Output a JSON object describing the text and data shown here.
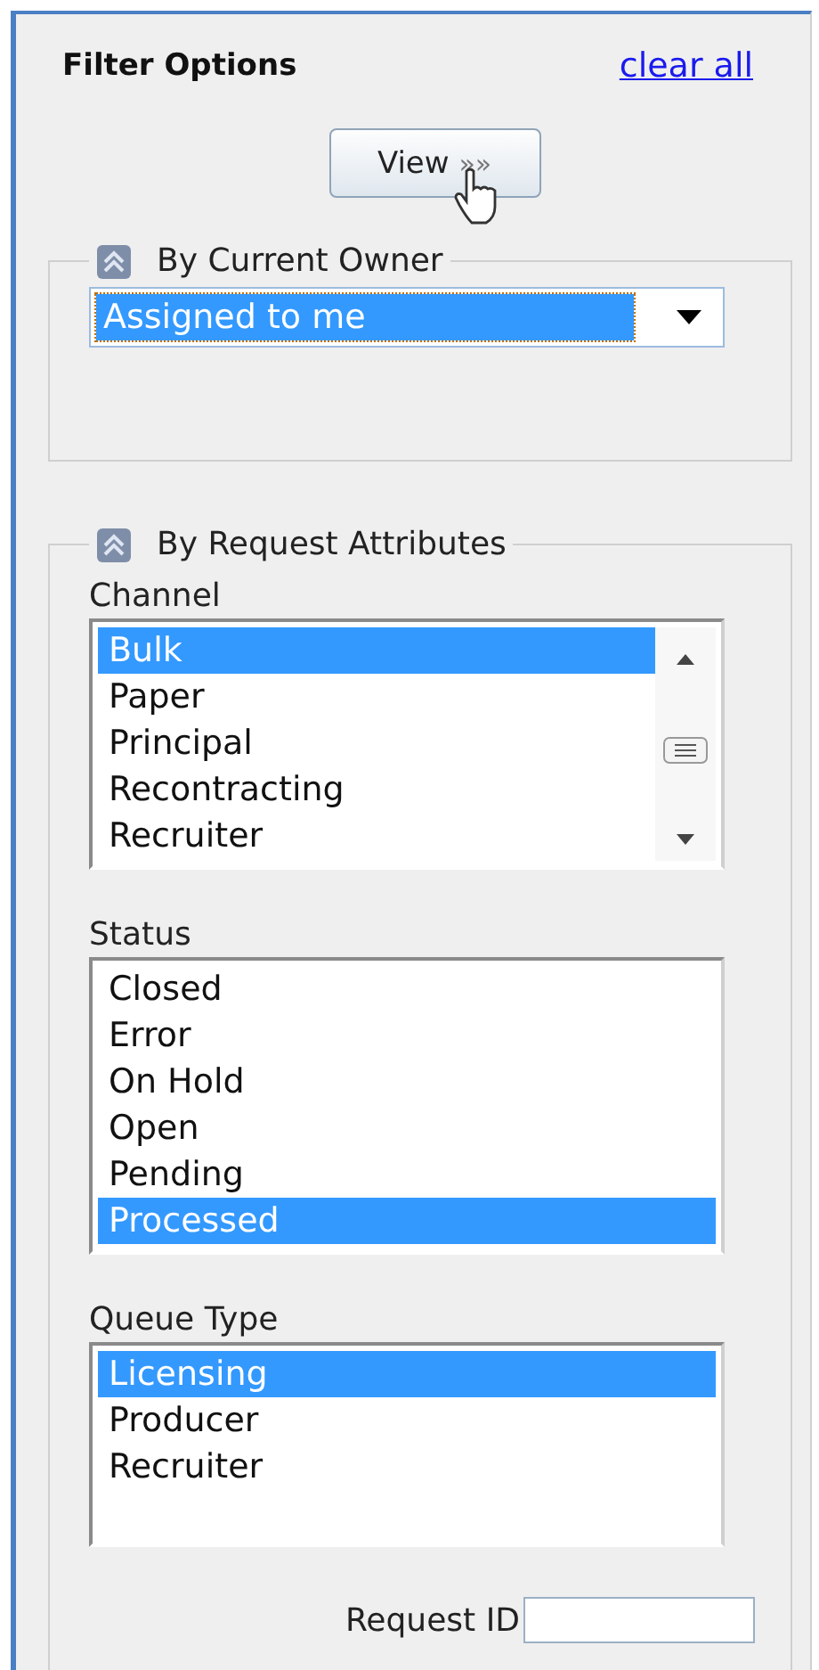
{
  "panel": {
    "title": "Filter Options",
    "clear_link": "clear all"
  },
  "view_button": {
    "label": "View",
    "arrows": "»»"
  },
  "owner_section": {
    "title": "By Current Owner",
    "expanded": true,
    "select": {
      "value": "Assigned to me",
      "highlighted": true
    }
  },
  "attributes_section": {
    "title": "By Request Attributes",
    "expanded": true,
    "lists": [
      {
        "label": "Channel",
        "scrollable": true,
        "items": [
          {
            "text": "Bulk",
            "selected": true
          },
          {
            "text": "Paper",
            "selected": false
          },
          {
            "text": "Principal",
            "selected": false
          },
          {
            "text": "Recontracting",
            "selected": false
          },
          {
            "text": "Recruiter",
            "selected": false
          }
        ]
      },
      {
        "label": "Status",
        "scrollable": false,
        "items": [
          {
            "text": "Closed",
            "selected": false
          },
          {
            "text": "Error",
            "selected": false
          },
          {
            "text": "On Hold",
            "selected": false
          },
          {
            "text": "Open",
            "selected": false
          },
          {
            "text": "Pending",
            "selected": false
          },
          {
            "text": "Processed",
            "selected": true
          }
        ]
      },
      {
        "label": "Queue Type",
        "scrollable": false,
        "items": [
          {
            "text": "Licensing",
            "selected": true
          },
          {
            "text": "Producer",
            "selected": false
          },
          {
            "text": "Recruiter",
            "selected": false
          }
        ]
      }
    ],
    "request_id": {
      "label": "Request ID"
    }
  }
}
